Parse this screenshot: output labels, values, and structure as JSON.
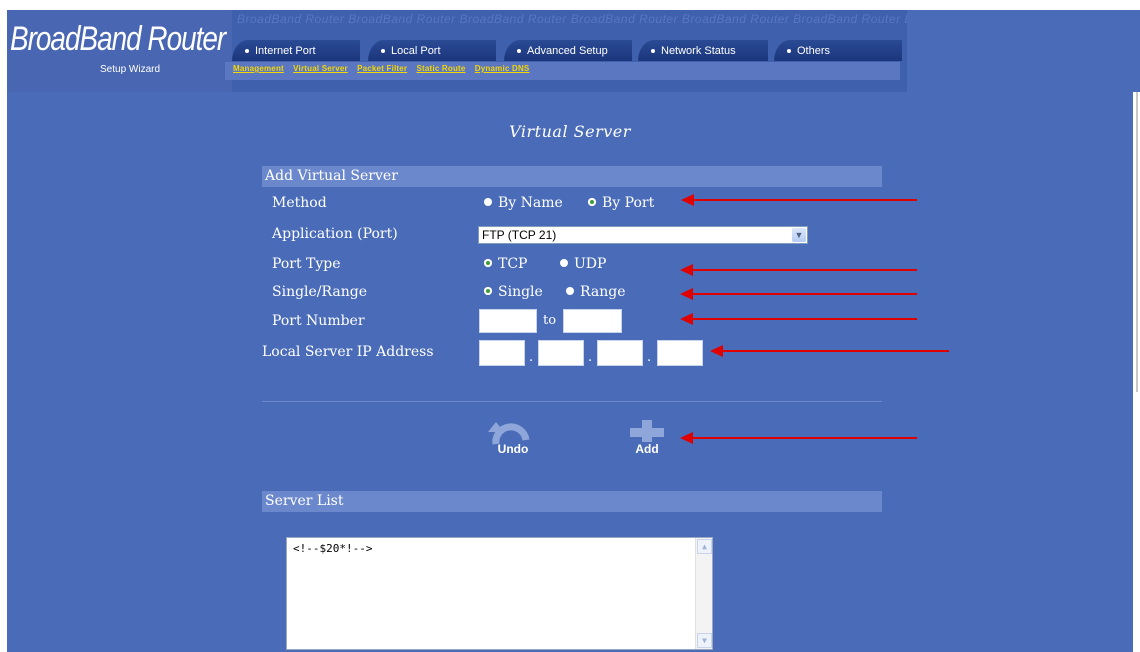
{
  "header": {
    "brand": "BroadBand Router",
    "subtitle": "Setup Wizard",
    "watermark": "BroadBand Router  BroadBand Router  BroadBand Router  BroadBand Router  BroadBand Router  BroadBand Router  BroadBand Router",
    "tabs": [
      "Internet Port",
      "Local Port",
      "Advanced Setup",
      "Network Status",
      "Others"
    ],
    "submenu": [
      "Management",
      "Virtual Server",
      "Packet Filter",
      "Static Route",
      "Dynamic DNS"
    ]
  },
  "page": {
    "title": "Virtual Server"
  },
  "add_section": {
    "heading": "Add Virtual Server",
    "method": {
      "label": "Method",
      "options": [
        "By Name",
        "By Port"
      ],
      "selected": "By Port"
    },
    "application": {
      "label": "Application (Port)",
      "value": "FTP (TCP 21)"
    },
    "port_type": {
      "label": "Port Type",
      "options": [
        "TCP",
        "UDP"
      ],
      "selected": "TCP"
    },
    "single_range": {
      "label": "Single/Range",
      "options": [
        "Single",
        "Range"
      ],
      "selected": "Single"
    },
    "port_number": {
      "label": "Port Number",
      "to": "to"
    },
    "local_ip": {
      "label": "Local Server IP Address",
      "separator": "."
    }
  },
  "buttons": {
    "undo": "Undo",
    "add": "Add"
  },
  "server_list": {
    "heading": "Server List",
    "content": "<!--$20*!-->"
  },
  "colors": {
    "background": "#4a6cb8",
    "section_bar": "#6c88cc",
    "link": "#f4d600",
    "annotation_arrow": "#e00000"
  }
}
